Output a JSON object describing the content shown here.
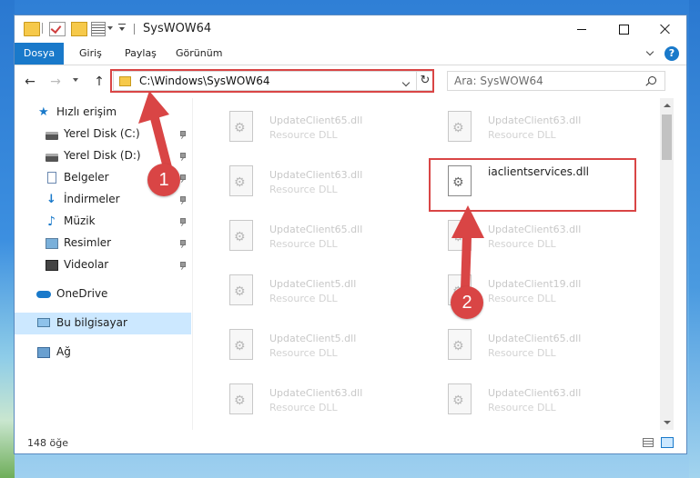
{
  "window": {
    "title": "SysWOW64"
  },
  "ribbon": {
    "tabs": [
      "Dosya",
      "Giriş",
      "Paylaş",
      "Görünüm"
    ],
    "help": "?"
  },
  "address": {
    "path": "C:\\Windows\\SysWOW64",
    "refresh": "↻"
  },
  "search": {
    "placeholder": "Ara: SysWOW64"
  },
  "sidebar": {
    "items": [
      {
        "label": "Hızlı erişim",
        "icon": "star-icon"
      },
      {
        "label": "Yerel Disk (C:)",
        "icon": "drive-icon",
        "pinned": true
      },
      {
        "label": "Yerel Disk (D:)",
        "icon": "drive-icon",
        "pinned": true
      },
      {
        "label": "Belgeler",
        "icon": "documents-icon",
        "pinned": true
      },
      {
        "label": "İndirmeler",
        "icon": "download-icon",
        "pinned": true
      },
      {
        "label": "Müzik",
        "icon": "music-icon",
        "pinned": true
      },
      {
        "label": "Resimler",
        "icon": "pictures-icon",
        "pinned": true
      },
      {
        "label": "Videolar",
        "icon": "videos-icon",
        "pinned": true
      },
      {
        "label": "OneDrive",
        "icon": "onedrive-icon"
      },
      {
        "label": "Bu bilgisayar",
        "icon": "this-pc-icon",
        "selected": true
      },
      {
        "label": "Ağ",
        "icon": "network-icon"
      }
    ]
  },
  "files": [
    {
      "name": "UpdateClient65.dll",
      "type": "Resource DLL"
    },
    {
      "name": "UpdateClient63.dll",
      "type": "Resource DLL"
    },
    {
      "name": "UpdateClient63.dll",
      "type": "Resource DLL"
    },
    {
      "name": "iaclientservices.dll",
      "type": "",
      "focused": true
    },
    {
      "name": "UpdateClient65.dll",
      "type": "Resource DLL"
    },
    {
      "name": "UpdateClient63.dll",
      "type": "Resource DLL"
    },
    {
      "name": "UpdateClient5.dll",
      "type": "Resource DLL"
    },
    {
      "name": "UpdateClient19.dll",
      "type": "Resource DLL"
    },
    {
      "name": "UpdateClient5.dll",
      "type": "Resource DLL"
    },
    {
      "name": "UpdateClient65.dll",
      "type": "Resource DLL"
    },
    {
      "name": "UpdateClient63.dll",
      "type": "Resource DLL"
    },
    {
      "name": "UpdateClient63.dll",
      "type": "Resource DLL"
    }
  ],
  "status": {
    "count": "148 öğe"
  },
  "annotations": {
    "step1": "1",
    "step2": "2",
    "color": "#d94545"
  },
  "colors": {
    "accent": "#1979ca",
    "selection": "#cce8ff"
  }
}
